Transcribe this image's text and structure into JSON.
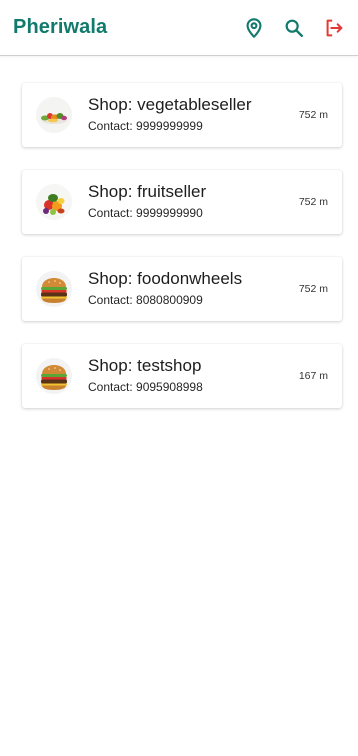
{
  "app_bar": {
    "title": "Pheriwala",
    "accent_color": "#127a6c",
    "logout_color": "#e53935",
    "icons": [
      "location-pin-icon",
      "search-icon",
      "logout-icon"
    ]
  },
  "shops": [
    {
      "name": "Shop: vegetableseller",
      "contact": "Contact: 9999999999",
      "distance": "752 m",
      "thumb_icon": "vegetables-icon"
    },
    {
      "name": "Shop: fruitseller",
      "contact": "Contact: 9999999990",
      "distance": "752 m",
      "thumb_icon": "fruits-icon"
    },
    {
      "name": "Shop: foodonwheels",
      "contact": "Contact: 8080800909",
      "distance": "752 m",
      "thumb_icon": "burger-icon"
    },
    {
      "name": "Shop: testshop",
      "contact": "Contact: 9095908998",
      "distance": "167 m",
      "thumb_icon": "burger-icon"
    }
  ]
}
